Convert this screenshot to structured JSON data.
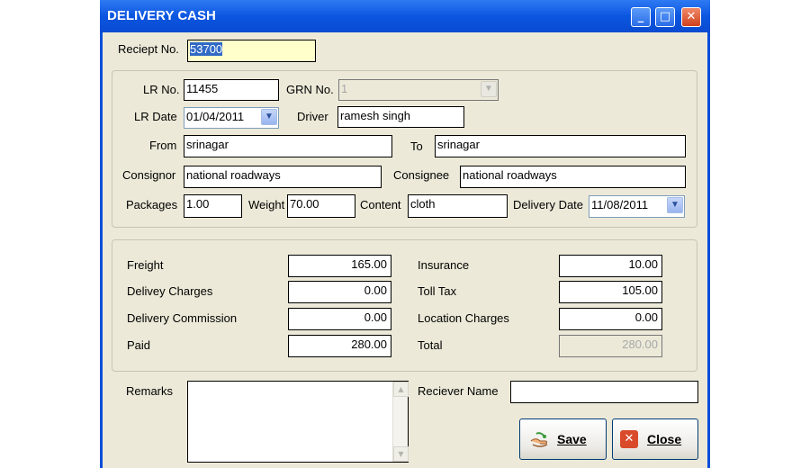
{
  "window": {
    "title": "DELIVERY CASH",
    "controls": {
      "minimize": "_",
      "maximize": "□",
      "close": "✕"
    }
  },
  "receipt": {
    "label": "Reciept No.",
    "value": "53700"
  },
  "lr_section": {
    "lr_no": {
      "label": "LR No.",
      "value": "11455"
    },
    "grn_no": {
      "label": "GRN No.",
      "value": "1"
    },
    "lr_date": {
      "label": "LR Date",
      "value": "01/04/2011"
    },
    "driver": {
      "label": "Driver",
      "value": "ramesh singh"
    },
    "from": {
      "label": "From",
      "value": "srinagar"
    },
    "to": {
      "label": "To",
      "value": "srinagar"
    },
    "consignor": {
      "label": "Consignor",
      "value": "national roadways"
    },
    "consignee": {
      "label": "Consignee",
      "value": "national roadways"
    },
    "packages": {
      "label": "Packages",
      "value": "1.00"
    },
    "weight": {
      "label": "Weight",
      "value": "70.00"
    },
    "content": {
      "label": "Content",
      "value": "cloth"
    },
    "delivery_date": {
      "label": "Delivery Date",
      "value": "11/08/2011"
    }
  },
  "charges": {
    "freight": {
      "label": "Freight",
      "value": "165.00"
    },
    "insurance": {
      "label": "Insurance",
      "value": "10.00"
    },
    "delivery_charges": {
      "label": "Delivey Charges",
      "value": "0.00"
    },
    "toll_tax": {
      "label": "Toll Tax",
      "value": "105.00"
    },
    "delivery_commission": {
      "label": "Delivery Commission",
      "value": "0.00"
    },
    "location_charges": {
      "label": "Location Charges",
      "value": "0.00"
    },
    "paid": {
      "label": "Paid",
      "value": "280.00"
    },
    "total": {
      "label": "Total",
      "value": "280.00"
    }
  },
  "footer": {
    "remarks": {
      "label": "Remarks",
      "value": ""
    },
    "receiver_name": {
      "label": "Reciever Name",
      "value": ""
    },
    "save_label": "Save",
    "close_label": "Close"
  },
  "colors": {
    "titlebar": "#0b56e0",
    "face": "#ece9d8",
    "receipt_bg": "#ffffcc",
    "selection": "#316ac5"
  }
}
